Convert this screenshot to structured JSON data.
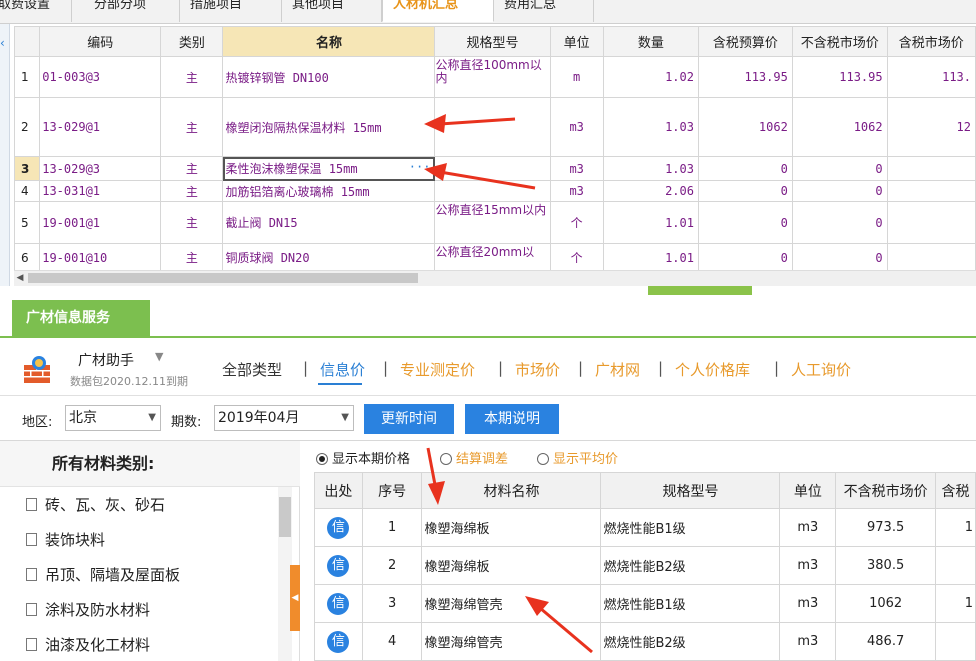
{
  "top_tabs": [
    "取费设置",
    "分部分项",
    "措施项目",
    "其他项目",
    "人材机汇总",
    "费用汇总"
  ],
  "active_top_tab": "人材机汇总",
  "upper_table": {
    "headers": [
      "编码",
      "类别",
      "名称",
      "规格型号",
      "单位",
      "数量",
      "含税预算价",
      "不含税市场价",
      "含税市场价"
    ],
    "rows": [
      {
        "idx": "1",
        "code": "01-003@3",
        "type": "主",
        "name": "热镀锌钢管 DN100",
        "spec": "公称直径100mm以内",
        "unit": "m",
        "qty": "1.02",
        "p1": "113.95",
        "p2": "113.95",
        "p3": "113."
      },
      {
        "idx": "2",
        "code": "13-029@1",
        "type": "主",
        "name": "橡塑闭泡隔热保温材料 15mm",
        "spec": "",
        "unit": "m3",
        "qty": "1.03",
        "p1": "1062",
        "p2": "1062",
        "p3": "12"
      },
      {
        "idx": "3",
        "code": "13-029@3",
        "type": "主",
        "name": "柔性泡沫橡塑保温  15mm",
        "spec": "",
        "unit": "m3",
        "qty": "1.03",
        "p1": "0",
        "p2": "0",
        "p3": ""
      },
      {
        "idx": "4",
        "code": "13-031@1",
        "type": "主",
        "name": "加筋铝箔离心玻璃棉 15mm",
        "spec": "",
        "unit": "m3",
        "qty": "2.06",
        "p1": "0",
        "p2": "0",
        "p3": ""
      },
      {
        "idx": "5",
        "code": "19-001@1",
        "type": "主",
        "name": "截止阀 DN15",
        "spec": "公称直径15mm以内",
        "unit": "个",
        "qty": "1.01",
        "p1": "0",
        "p2": "0",
        "p3": ""
      },
      {
        "idx": "6",
        "code": "19-001@10",
        "type": "主",
        "name": "铜质球阀 DN20",
        "spec": "公称直径20mm以",
        "unit": "个",
        "qty": "1.01",
        "p1": "0",
        "p2": "0",
        "p3": ""
      }
    ],
    "ellipsis": "···"
  },
  "service": {
    "tab_label": "广材信息服务",
    "helper_title": "广材助手",
    "helper_caret": "▼",
    "helper_sub": "数据包2020.12.11到期",
    "category_tabs": [
      "全部类型",
      "信息价",
      "专业测定价",
      "市场价",
      "广材网",
      "个人价格库",
      "人工询价"
    ],
    "active_category_tab": "信息价",
    "separator": "|"
  },
  "filter": {
    "region_label": "地区:",
    "region_value": "北京",
    "period_label": "期数:",
    "period_value": "2019年04月",
    "update_button": "更新时间",
    "explain_button": "本期说明",
    "dropdown_glyph": "▼"
  },
  "categories": {
    "title": "所有材料类别:",
    "items": [
      "砖、瓦、灰、砂石",
      "装饰块料",
      "吊顶、隔墙及屋面板",
      "涂料及防水材料",
      "油漆及化工材料"
    ]
  },
  "radios": [
    {
      "label": "显示本期价格",
      "checked": true,
      "color": "#222222"
    },
    {
      "label": "结算调差",
      "checked": false,
      "color": "#e89a2c"
    },
    {
      "label": "显示平均价",
      "checked": false,
      "color": "#e89a2c"
    }
  ],
  "lower_table": {
    "headers": [
      "出处",
      "序号",
      "材料名称",
      "规格型号",
      "单位",
      "不含税市场价",
      "含税"
    ],
    "source_badge": "信",
    "rows": [
      {
        "no": "1",
        "name": "橡塑海绵板",
        "spec": "燃烧性能B1级",
        "unit": "m3",
        "price": "973.5",
        "tax": "1"
      },
      {
        "no": "2",
        "name": "橡塑海绵板",
        "spec": "燃烧性能B2级",
        "unit": "m3",
        "price": "380.5",
        "tax": ""
      },
      {
        "no": "3",
        "name": "橡塑海绵管壳",
        "spec": "燃烧性能B1级",
        "unit": "m3",
        "price": "1062",
        "tax": "1"
      },
      {
        "no": "4",
        "name": "橡塑海绵管壳",
        "spec": "燃烧性能B2级",
        "unit": "m3",
        "price": "486.7",
        "tax": ""
      }
    ]
  },
  "colors": {
    "accent_green": "#7cbf4f",
    "accent_blue": "#2a82e0",
    "accent_orange": "#e89a2c",
    "arrow_red": "#e8321e"
  }
}
